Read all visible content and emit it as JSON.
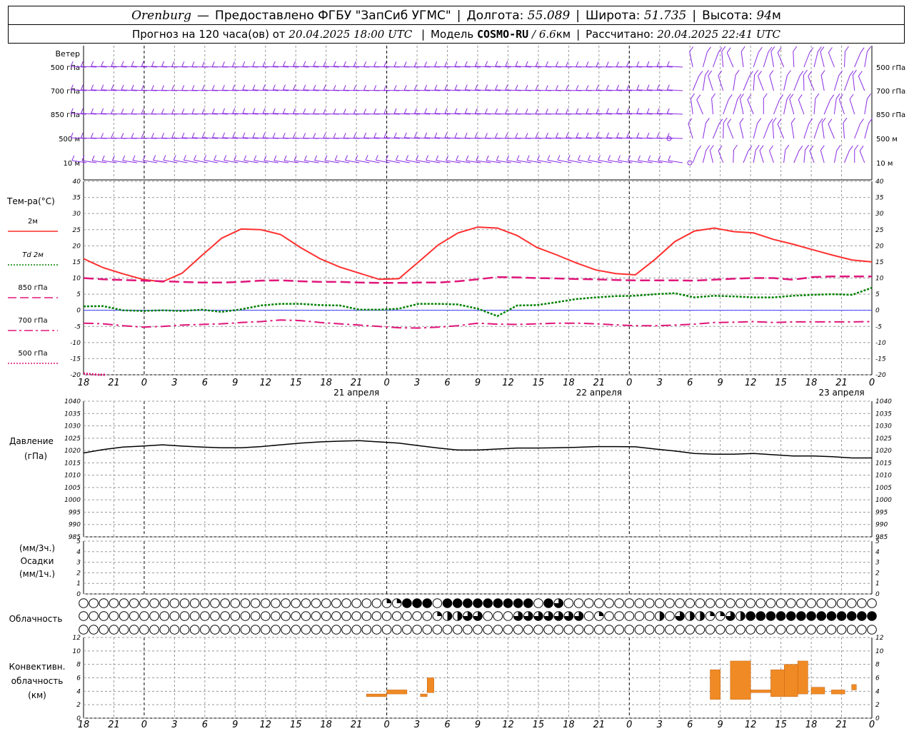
{
  "header": {
    "city": "Orenburg",
    "dash": "—",
    "provider": "Предоставлено ФГБУ \"ЗапСиб УГМС\"",
    "lon_label": "Долгота:",
    "lon_value": "55.089",
    "lat_label": "Широта:",
    "lat_value": "51.735",
    "alt_label": "Высота:",
    "alt_value": "94",
    "alt_unit": "м",
    "forecast_label": "Прогноз на 120 часа(ов) от",
    "forecast_start": "20.04.2025 18:00 UTC",
    "model_label": "Модель",
    "model_name": "COSMO-RU",
    "model_res": "/ 6.6",
    "model_unit": "км",
    "calc_label": "Рассчитано:",
    "calc_time": "20.04.2025 22:41 UTC"
  },
  "labels": {
    "wind": "Ветер",
    "wind_levels": [
      "500 гПа",
      "700 гПа",
      "850 гПа",
      "500  м",
      "10  м"
    ],
    "temp_title": "Тем-ра(°С)",
    "temp_legend": [
      {
        "label": "2м",
        "color": "#ff2a2a",
        "dash": "solid"
      },
      {
        "label": "Td  2м",
        "color": "#008000",
        "dash": "dot"
      },
      {
        "label": "850 гПа",
        "color": "#e0157a",
        "dash": "dash"
      },
      {
        "label": "700 гПа",
        "color": "#e0157a",
        "dash": "dashdot"
      },
      {
        "label": "500 гПа",
        "color": "#e0157a",
        "dash": "dot"
      }
    ],
    "pressure_title": "Давление",
    "pressure_unit": "(гПа)",
    "precip_lines": [
      "(мм/3ч.)",
      "Осадки",
      "(мм/1ч.)"
    ],
    "cloud_title": "Облачность",
    "conv_lines": [
      "Конвективн.",
      "облачность",
      "(км)"
    ]
  },
  "time_axis": {
    "hour_labels": [
      "18",
      "21",
      "0",
      "3",
      "6",
      "9",
      "12",
      "15",
      "18",
      "21",
      "0",
      "3",
      "6",
      "9",
      "12",
      "15",
      "18",
      "21",
      "0",
      "3",
      "6",
      "9",
      "12",
      "15",
      "18",
      "21",
      "0"
    ],
    "day_labels": [
      {
        "label": "21 апреля",
        "index": 9
      },
      {
        "label": "22 апреля",
        "index": 17
      },
      {
        "label": "23 апреля",
        "index": 25
      }
    ]
  },
  "colors": {
    "wind": "#8a2be2",
    "t2m": "#ff3030",
    "td2m": "#008000",
    "upper": "#e0157a",
    "pressure": "#000000",
    "conv": "#f08a24",
    "zero_line": "#4040ff"
  },
  "chart_data": [
    {
      "type": "line",
      "title": "Тем-ра(°С)",
      "ylim": [
        -20,
        40
      ],
      "yticks": [
        -20,
        -15,
        -10,
        -5,
        0,
        5,
        10,
        15,
        20,
        25,
        30,
        35,
        40
      ],
      "x_hours": [
        0,
        3,
        6,
        9,
        12,
        15,
        18,
        21,
        24,
        27,
        30,
        33,
        36,
        39,
        42,
        45,
        48,
        51,
        54,
        57,
        60,
        63,
        66,
        69,
        72,
        75,
        78
      ],
      "series": [
        {
          "name": "2м",
          "values": [
            16,
            13.2,
            11.3,
            9.6,
            8.8,
            11.5,
            17,
            22.3,
            25.2,
            25,
            23.5,
            19.5,
            16,
            13.4,
            11.5,
            9.6,
            9.8,
            15,
            20.3,
            24,
            25.8,
            25.5,
            23.2,
            19.5,
            17.2,
            14.7,
            12.5,
            11.4,
            11,
            15.8,
            21.3,
            24.6,
            25.5,
            24.4,
            24,
            22,
            20.5,
            18.8,
            17.1,
            15.6,
            15
          ]
        },
        {
          "name": "Td  2м",
          "values": [
            1.2,
            1.3,
            0,
            -0.2,
            0,
            -0.2,
            0.2,
            -0.5,
            0.3,
            1.5,
            2,
            2,
            1.6,
            1.5,
            0.2,
            0.2,
            0.5,
            2,
            2,
            1.8,
            0.5,
            -1.8,
            1.5,
            1.6,
            2.5,
            3.5,
            4,
            4.4,
            4.5,
            5,
            5.3,
            4,
            4.5,
            4.3,
            4,
            4,
            4.5,
            4.8,
            5,
            4.8,
            7
          ]
        },
        {
          "name": "850 гПа",
          "values": [
            10,
            9.6,
            9.4,
            9.2,
            9,
            8.8,
            8.6,
            8.6,
            8.8,
            9.2,
            9.3,
            9,
            8.8,
            8.8,
            8.6,
            8.5,
            8.5,
            8.6,
            8.6,
            9,
            9.6,
            10.3,
            10.2,
            10,
            9.9,
            9.7,
            9.6,
            9.4,
            9.3,
            9.3,
            9.3,
            9.2,
            9.5,
            9.8,
            10,
            10,
            9.5,
            10.3,
            10.5,
            10.5,
            10.5
          ]
        },
        {
          "name": "700 гПа",
          "values": [
            -4,
            -4.2,
            -4.8,
            -5.2,
            -5,
            -4.6,
            -4.4,
            -4.2,
            -3.8,
            -3.5,
            -3,
            -3.2,
            -3.8,
            -4.2,
            -4.6,
            -5,
            -5.4,
            -5.5,
            -5.2,
            -4.8,
            -4,
            -4.3,
            -4.4,
            -4.2,
            -4,
            -4,
            -4.2,
            -4.5,
            -4.8,
            -4.8,
            -4.6,
            -4.3,
            -3.8,
            -3.7,
            -3.5,
            -3.8,
            -3.6,
            -3.6,
            -3.6,
            -3.6,
            -3.5
          ]
        },
        {
          "name": "500 гПа",
          "values": [
            -19.6,
            -19.8,
            -20,
            -20
          ]
        }
      ]
    },
    {
      "type": "line",
      "title": "Давление",
      "ylim": [
        985,
        1040
      ],
      "yticks": [
        985,
        990,
        995,
        1000,
        1005,
        1010,
        1015,
        1020,
        1025,
        1030,
        1035,
        1040
      ],
      "series": [
        {
          "name": "Давление",
          "values": [
            1019,
            1020.4,
            1021.4,
            1021.8,
            1022.3,
            1021.8,
            1021.4,
            1021.1,
            1021.1,
            1021.6,
            1022.3,
            1023,
            1023.5,
            1023.8,
            1024,
            1023.5,
            1023,
            1022,
            1021,
            1020.2,
            1020.2,
            1020.6,
            1021,
            1021,
            1021.1,
            1021.3,
            1021.6,
            1021.6,
            1021.5,
            1020.6,
            1019.8,
            1018.8,
            1018.5,
            1018.5,
            1018.8,
            1018.3,
            1017.8,
            1017.8,
            1017.5,
            1017,
            1017
          ]
        }
      ]
    },
    {
      "type": "bar",
      "title": "Осадки",
      "ylim": [
        0,
        5
      ],
      "yticks": [
        0,
        1,
        2,
        3,
        4,
        5
      ],
      "values": []
    },
    {
      "type": "bar",
      "title": "Конвективн. облачность (км)",
      "ylim": [
        0,
        12
      ],
      "yticks": [
        0,
        2,
        4,
        6,
        8,
        10,
        12
      ],
      "bars": [
        {
          "h_start": 42,
          "h_end": 45,
          "base": 3.2,
          "top": 3.6
        },
        {
          "h_start": 45,
          "h_end": 48,
          "base": 3.6,
          "top": 4.2
        },
        {
          "h_start": 50,
          "h_end": 51,
          "base": 3.2,
          "top": 3.6
        },
        {
          "h_start": 51,
          "h_end": 52,
          "base": 3.8,
          "top": 6
        },
        {
          "h_start": 93,
          "h_end": 94.5,
          "base": 2.8,
          "top": 7.2
        },
        {
          "h_start": 96,
          "h_end": 99,
          "base": 2.8,
          "top": 8.5
        },
        {
          "h_start": 99,
          "h_end": 102,
          "base": 3.8,
          "top": 4.2
        },
        {
          "h_start": 102,
          "h_end": 104,
          "base": 3.2,
          "top": 7.2
        },
        {
          "h_start": 104,
          "h_end": 106,
          "base": 3.2,
          "top": 8
        },
        {
          "h_start": 106,
          "h_end": 107.5,
          "base": 3.6,
          "top": 8.5
        },
        {
          "h_start": 108,
          "h_end": 110,
          "base": 3.6,
          "top": 4.6
        },
        {
          "h_start": 111,
          "h_end": 113,
          "base": 3.6,
          "top": 4.2
        },
        {
          "h_start": 114,
          "h_end": 114.7,
          "base": 4.2,
          "top": 5
        }
      ]
    }
  ],
  "clouds": {
    "rows": [
      "0000000000000000000000000000000000000000000000111444040444444444444404044300000000000000000000000000000000000000000000000000",
      "00000000000000000000000000000000000000000000000000001322133200003333333333001000000002003222211332244444444444444444444",
      "0000000000000000000000000000000000000000000000000000000000000000000000000000000000000000000000000000000000000000000000000"
    ],
    "note": "0=clear,1=quarter,2=half,3=three-quarter,4=overcast"
  }
}
